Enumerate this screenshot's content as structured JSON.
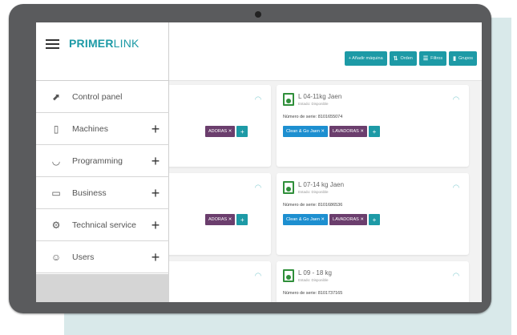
{
  "app": {
    "logo_primary": "PRIMER",
    "logo_secondary": "LINK"
  },
  "toolbar": {
    "add_machine": "+ Añadir máquina",
    "order": "Orden",
    "filters": "Filtros",
    "groups": "Grupos"
  },
  "sidebar": {
    "items": [
      {
        "label": "Control panel",
        "icon": "chart-icon",
        "expandable": false
      },
      {
        "label": "Machines",
        "icon": "washing-machine-icon",
        "expandable": true
      },
      {
        "label": "Programming",
        "icon": "wash-tub-icon",
        "expandable": true
      },
      {
        "label": "Business",
        "icon": "briefcase-icon",
        "expandable": true
      },
      {
        "label": "Technical service",
        "icon": "gear-hand-icon",
        "expandable": true
      },
      {
        "label": "Users",
        "icon": "users-icon",
        "expandable": true
      }
    ]
  },
  "cards": [
    {
      "name": "L 04-11kg Jaen",
      "status": "Estado: Disponible",
      "serial": "Número de serie: 8101655074",
      "tags": [
        "Clean & Go Jaen ✕",
        "LAVADORAS ✕"
      ]
    },
    {
      "name": "L 07-14 kg Jaen",
      "status": "Estado: Disponible",
      "serial": "Número de serie: 8101686536",
      "tags": [
        "Clean & Go Jaen ✕",
        "LAVADORAS ✕"
      ]
    },
    {
      "name": "L 09 - 18 kg",
      "status": "Estado: Disponible",
      "serial": "Número de serie: 8101737165",
      "tags": []
    }
  ],
  "left_cards": {
    "tag_partial": "ADORAS ✕"
  },
  "colors": {
    "accent": "#1d9aa6",
    "tag_blue": "#1d8fd0",
    "tag_purple": "#6b3e6d",
    "machine_green": "#2f8f3a",
    "background_panel": "#d9e9ea"
  }
}
